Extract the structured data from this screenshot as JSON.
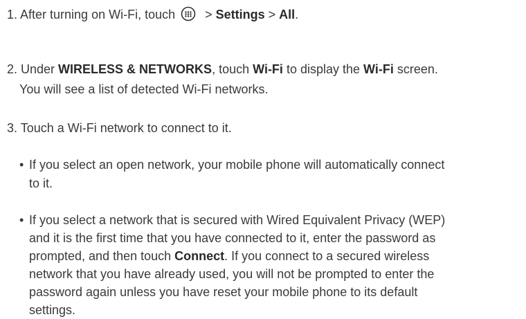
{
  "step1": {
    "prefix": "1. After turning on Wi-Fi, touch",
    "icon": "apps-menu-icon",
    "sep1": " > ",
    "settings": "Settings",
    "sep2": " > ",
    "all": "All",
    "end": "."
  },
  "step2": {
    "prefix": "2. Under ",
    "wireless": "WIRELESS & NETWORKS",
    "mid1": ", touch ",
    "wifi1": "Wi-Fi",
    "mid2": " to display the ",
    "wifi2": "Wi-Fi",
    "suffix": " screen.",
    "line2": "You will see a list of detected Wi-Fi networks."
  },
  "step3": {
    "text": "3. Touch a Wi-Fi network to connect to it."
  },
  "bullet1": {
    "marker": "•",
    "line1": "If you select an open network, your mobile phone will automatically connect",
    "line2": "to it."
  },
  "bullet2": {
    "marker": "•",
    "line1": "If you select a network that is secured with Wired Equivalent Privacy (WEP)",
    "line2": "and it is the first time that you have connected to it, enter the password as",
    "line3_pre": "prompted, and then touch ",
    "connect": "Connect",
    "line3_post": ". If you connect to a secured wireless",
    "line4": "network that you have already used, you will not be prompted to enter the",
    "line5": "password again unless you have reset your mobile phone to its default",
    "line6": "settings."
  }
}
